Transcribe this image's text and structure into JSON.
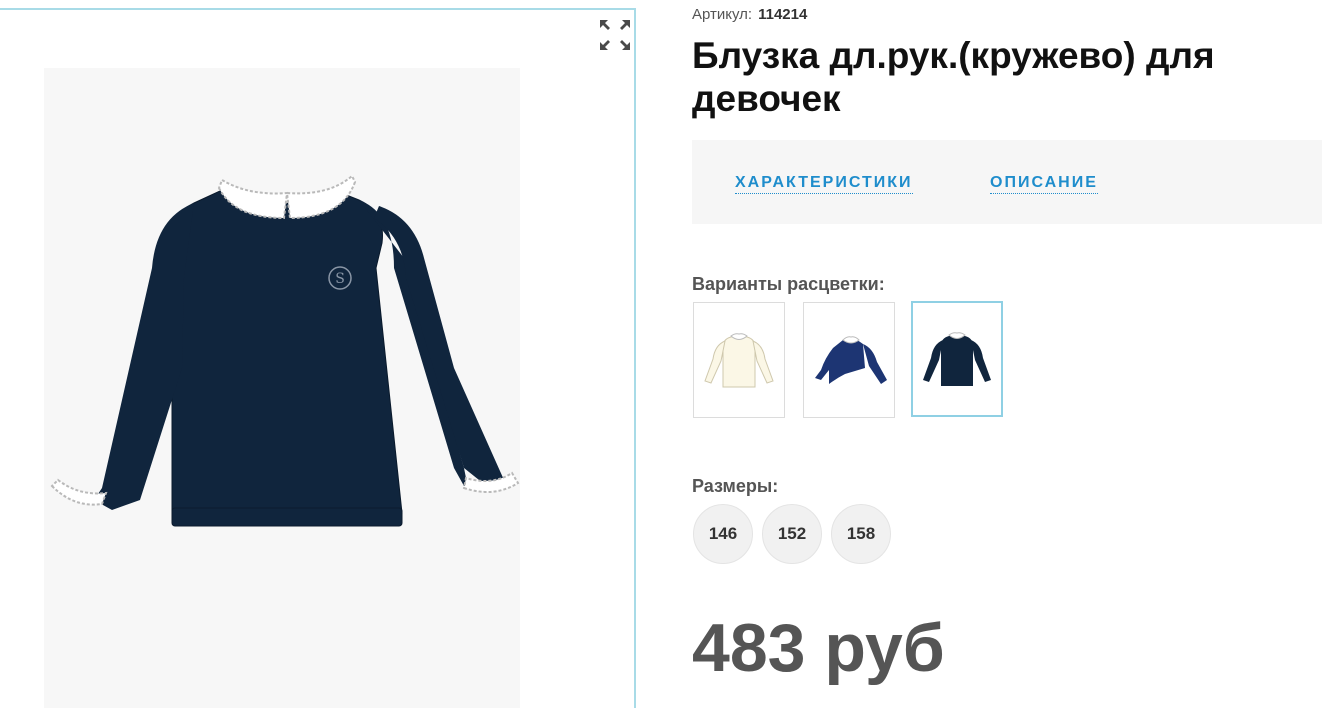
{
  "product": {
    "sku_label": "Артикул:",
    "sku_value": "114214",
    "title": "Блузка дл.рук.(кружево) для девочек"
  },
  "tabs": [
    {
      "label": "ХАРАКТЕРИСТИКИ"
    },
    {
      "label": "ОПИСАНИЕ"
    }
  ],
  "colors": {
    "label": "Варианты расцветки:",
    "options": [
      {
        "name": "cream",
        "hex": "#fbf7e6",
        "selected": false
      },
      {
        "name": "navy-blue",
        "hex": "#1d3573",
        "selected": false
      },
      {
        "name": "dark-navy",
        "hex": "#10253d",
        "selected": true
      }
    ]
  },
  "sizes": {
    "label": "Размеры:",
    "options": [
      "146",
      "152",
      "158"
    ]
  },
  "price": "483 руб",
  "icons": {
    "expand": "expand-icon"
  },
  "theme": {
    "accent": "#1f8dcc",
    "viewer_border": "#a8dbe7",
    "garment": "#10253d"
  }
}
